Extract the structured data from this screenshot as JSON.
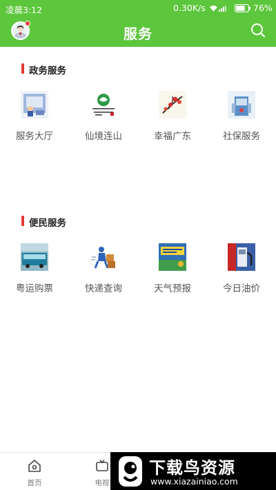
{
  "status_bar": {
    "time": "凌晨3:12",
    "net_speed": "0.30K/s",
    "battery": "76%"
  },
  "header": {
    "title": "服务"
  },
  "sections": [
    {
      "title": "政务服务",
      "items": [
        {
          "label": "服务大厅",
          "icon": "service-hall-icon"
        },
        {
          "label": "仙境连山",
          "icon": "xianjing-lianshan-logo"
        },
        {
          "label": "幸福广东",
          "icon": "xingfu-guangdong-icon"
        },
        {
          "label": "社保服务",
          "icon": "social-security-icon"
        }
      ]
    },
    {
      "title": "便民服务",
      "items": [
        {
          "label": "粤运购票",
          "icon": "bus-ticket-icon"
        },
        {
          "label": "快递查询",
          "icon": "courier-icon"
        },
        {
          "label": "天气预报",
          "icon": "weather-forecast-icon"
        },
        {
          "label": "今日油价",
          "icon": "fuel-price-icon"
        }
      ]
    }
  ],
  "bottom_nav": [
    {
      "label": "首页",
      "icon": "home-icon"
    },
    {
      "label": "电视",
      "icon": "tv-icon"
    }
  ],
  "watermark": {
    "title": "下载鸟资源",
    "url": "www.xiazainiao.com"
  },
  "colors": {
    "brand_green": "#5cc63c",
    "section_accent_red": "#e53935"
  }
}
